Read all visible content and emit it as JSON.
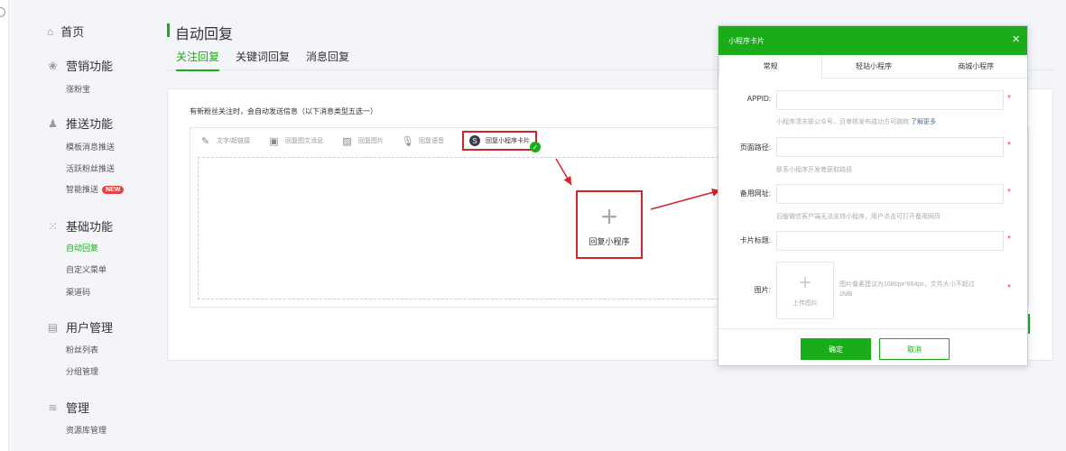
{
  "sidebar": {
    "home": "首页",
    "groups": [
      {
        "label": "营销功能",
        "icon": "marketing-icon",
        "items": [
          {
            "label": "涨粉宝"
          }
        ]
      },
      {
        "label": "推送功能",
        "icon": "push-icon",
        "items": [
          {
            "label": "模板消息推送"
          },
          {
            "label": "活跃粉丝推送"
          },
          {
            "label": "智能推送",
            "badge": "NEW"
          }
        ]
      },
      {
        "label": "基础功能",
        "icon": "grid-icon",
        "items": [
          {
            "label": "自动回复",
            "active": true
          },
          {
            "label": "自定义菜单"
          },
          {
            "label": "渠道码"
          }
        ]
      },
      {
        "label": "用户管理",
        "icon": "user-icon",
        "items": [
          {
            "label": "粉丝列表"
          },
          {
            "label": "分组管理"
          }
        ]
      },
      {
        "label": "管理",
        "icon": "manage-icon",
        "items": [
          {
            "label": "资源库管理"
          }
        ]
      }
    ]
  },
  "page": {
    "title": "自动回复",
    "tabs": [
      "关注回复",
      "关键词回复",
      "消息回复"
    ],
    "description": "有新粉丝关注时，会自动发送信息（以下消息类型五选一）"
  },
  "toolbar": {
    "items": [
      {
        "label": "文字/超链接",
        "icon": "pencil-icon"
      },
      {
        "label": "回复图文消息",
        "icon": "article-icon"
      },
      {
        "label": "回复图片",
        "icon": "image-icon"
      },
      {
        "label": "回复语音",
        "icon": "mic-icon"
      },
      {
        "label": "回复小程序卡片",
        "icon": "miniprogram-icon"
      }
    ]
  },
  "add_box": {
    "plus": "+",
    "label": "回复小程序"
  },
  "modal": {
    "title": "小程序卡片",
    "close": "×",
    "tabs": [
      "常规",
      "轻站小程序",
      "商城小程序"
    ],
    "fields": {
      "appid_label": "APPID:",
      "appid_hint": "小程序须关联公众号，且审核发布成功方可跳转",
      "appid_link": "了解更多",
      "path_label": "页面路径:",
      "path_hint": "联系小程序开发者获取路径",
      "backup_label": "备用网址:",
      "backup_hint": "旧版微信客户端无法支持小程序，用户点击可打开备用网页",
      "card_title_label": "卡片标题:",
      "image_label": "图片:",
      "upload_plus": "+",
      "upload_label": "上传图片",
      "image_hint": "图片像素建议为1080px*864px，文件大小不超过2MB",
      "required_mark": "*"
    },
    "confirm": "确定",
    "cancel": "取消"
  },
  "colors": {
    "accent": "#1aad19",
    "highlight": "#d0262a",
    "badge": "#e64340"
  }
}
